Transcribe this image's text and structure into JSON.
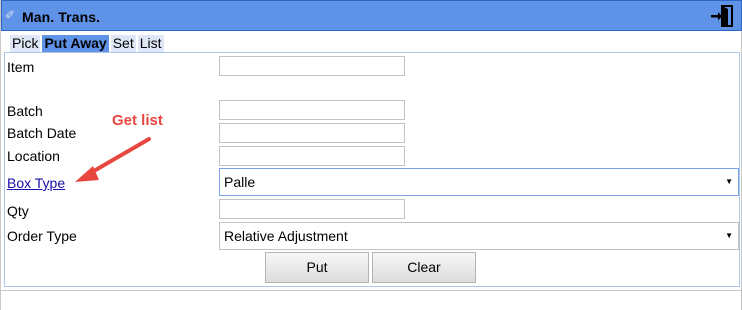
{
  "window": {
    "title": "Man. Trans.",
    "pin_icon": "pin-icon",
    "exit_icon": "exit-door-icon"
  },
  "tabs": [
    {
      "label": "Pick",
      "active": false
    },
    {
      "label": "Put Away",
      "active": true
    },
    {
      "label": "Set",
      "active": false
    },
    {
      "label": "List",
      "active": false
    }
  ],
  "form": {
    "item_label": "Item",
    "item_value": "",
    "batch_label": "Batch",
    "batch_value": "",
    "batch_date_label": "Batch Date",
    "batch_date_value": "",
    "location_label": "Location",
    "location_value": "",
    "box_type_label": "Box Type",
    "box_type_selected": "Palle",
    "qty_label": "Qty",
    "qty_value": "",
    "order_type_label": "Order Type",
    "order_type_selected": "Relative Adjustment"
  },
  "buttons": {
    "put_label": "Put",
    "clear_label": "Clear"
  },
  "annotation": {
    "text": "Get list",
    "color": "#e8473f"
  },
  "colors": {
    "titlebar": "#5f93e8",
    "tab_active": "#5f93e8",
    "tab_inactive": "#dfe7f6",
    "link": "#1a0dab"
  }
}
